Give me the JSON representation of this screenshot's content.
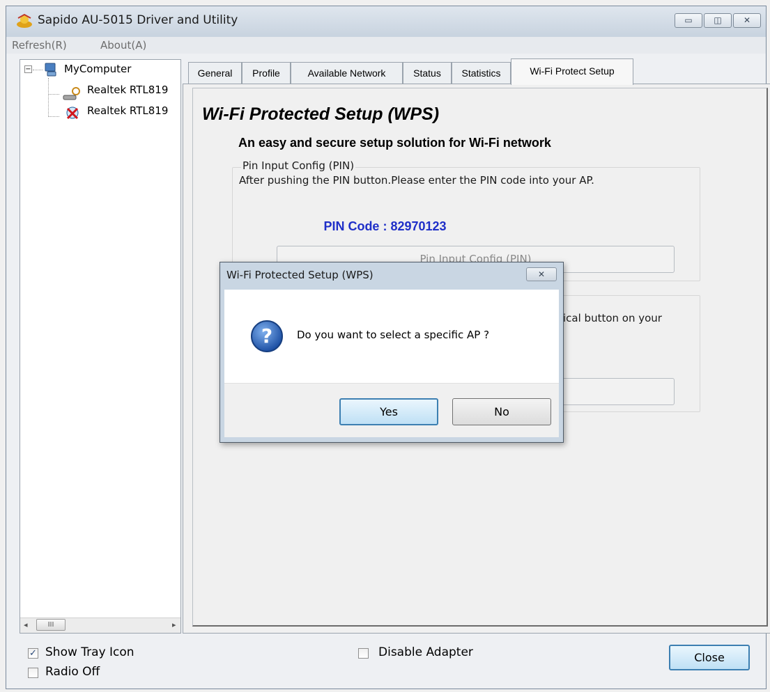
{
  "window": {
    "title": "Sapido AU-5015 Driver and Utility",
    "controls": {
      "minimize": "▭",
      "maximize": "◫",
      "close": "✕"
    }
  },
  "menu": [
    "Refresh(R)",
    "About(A)"
  ],
  "tree": {
    "root": "MyComputer",
    "expander": "−",
    "children": [
      "Realtek RTL819",
      "Realtek RTL819"
    ]
  },
  "scrollbar": {
    "left": "◂",
    "thumb": "III",
    "right": "▸"
  },
  "tabs": [
    "General",
    "Profile",
    "Available Network",
    "Status",
    "Statistics",
    "Wi-Fi Protect Setup"
  ],
  "wps": {
    "title": "Wi-Fi Protected Setup (WPS)",
    "subtitle": "An easy and secure setup solution for Wi-Fi network",
    "pin_group": {
      "label": "Pin Input Config (PIN)",
      "description": "After pushing the PIN button.Please enter the PIN code into your AP.",
      "pin_code_label": "PIN Code :",
      "pin_code": "82970123",
      "button": "Pin Input Config (PIN)"
    },
    "pbc_group": {
      "description_visible": "ical button on your"
    }
  },
  "dialog": {
    "title": "Wi-Fi Protected Setup (WPS)",
    "close": "✕",
    "message": "Do you want to select a specific AP ?",
    "icon_glyph": "?",
    "yes": "Yes",
    "no": "No"
  },
  "bottom": {
    "show_tray_icon": {
      "label": "Show Tray Icon",
      "checked": true,
      "mark": "✓"
    },
    "radio_off": {
      "label": "Radio Off",
      "checked": false
    },
    "disable_adapter": {
      "label": "Disable Adapter",
      "checked": false
    },
    "close": "Close"
  },
  "colors": {
    "pin_code": "#1f2fc8",
    "dialog_frame": "#c9d6e3",
    "default_button": "#3c7fb1"
  }
}
